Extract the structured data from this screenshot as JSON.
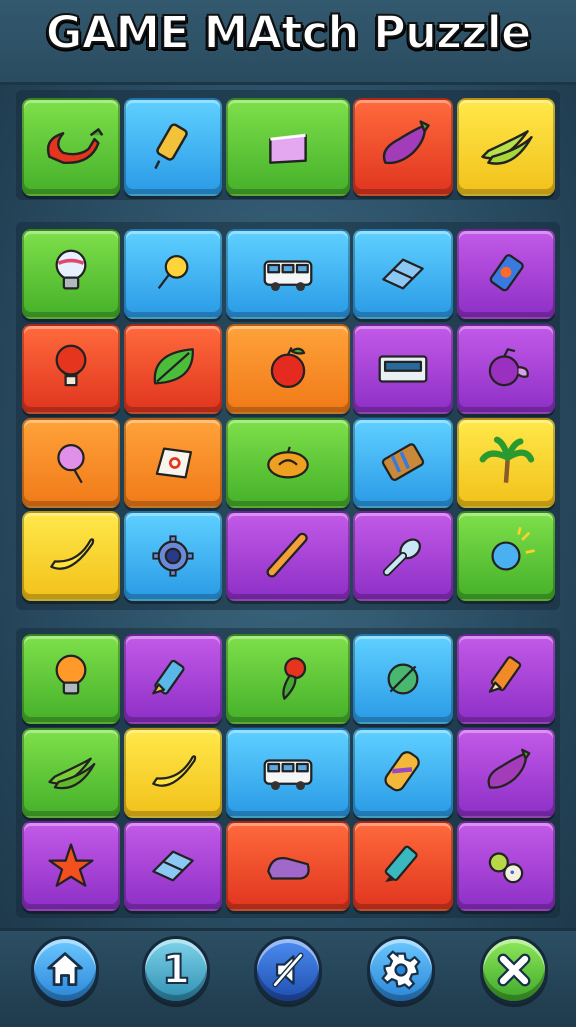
{
  "title": "GAME MAtch Puzzle",
  "colors": {
    "green": "#45b02a",
    "blue": "#2a9ae6",
    "red": "#e0351f",
    "yellow": "#f2c11a",
    "purple": "#8d2fc6",
    "orange": "#f07a18"
  },
  "board": {
    "top_row": [
      {
        "color": "green",
        "item": "chili-pepper-icon"
      },
      {
        "color": "blue",
        "item": "golden-toy-icon"
      },
      {
        "color": "green",
        "item": "pink-crate-icon"
      },
      {
        "color": "red",
        "item": "eggplant-icon"
      },
      {
        "color": "yellow",
        "item": "banana-bunch-icon"
      }
    ],
    "middle_rows": [
      [
        {
          "color": "green",
          "item": "lightbulb-icon"
        },
        {
          "color": "blue",
          "item": "corn-pin-icon"
        },
        {
          "color": "blue",
          "item": "van-icon"
        },
        {
          "color": "blue",
          "item": "eraser-icon"
        },
        {
          "color": "purple",
          "item": "soda-can-icon"
        }
      ],
      [
        {
          "color": "red",
          "item": "hot-air-balloon-icon"
        },
        {
          "color": "red",
          "item": "leaf-icon"
        },
        {
          "color": "orange",
          "item": "apple-icon"
        },
        {
          "color": "purple",
          "item": "radio-icon"
        },
        {
          "color": "purple",
          "item": "purple-apple-icon"
        }
      ],
      [
        {
          "color": "orange",
          "item": "cotton-candy-icon"
        },
        {
          "color": "orange",
          "item": "tag-icon"
        },
        {
          "color": "green",
          "item": "pumpkin-icon"
        },
        {
          "color": "blue",
          "item": "toy-box-icon"
        },
        {
          "color": "yellow",
          "item": "palm-tree-icon"
        }
      ],
      [
        {
          "color": "yellow",
          "item": "banana-icon"
        },
        {
          "color": "blue",
          "item": "gear-icon"
        },
        {
          "color": "purple",
          "item": "baton-icon"
        },
        {
          "color": "purple",
          "item": "spoon-icon"
        },
        {
          "color": "green",
          "item": "planet-icon"
        }
      ]
    ],
    "bottom_rows": [
      [
        {
          "color": "green",
          "item": "orange-bulb-icon"
        },
        {
          "color": "purple",
          "item": "crayon-icon"
        },
        {
          "color": "green",
          "item": "pepper-icon"
        },
        {
          "color": "blue",
          "item": "compass-icon"
        },
        {
          "color": "purple",
          "item": "orange-crayon-icon"
        }
      ],
      [
        {
          "color": "green",
          "item": "green-banana-icon"
        },
        {
          "color": "yellow",
          "item": "banana-icon"
        },
        {
          "color": "blue",
          "item": "van-icon"
        },
        {
          "color": "blue",
          "item": "striped-cylinder-icon"
        },
        {
          "color": "purple",
          "item": "eggplant-icon"
        }
      ],
      [
        {
          "color": "purple",
          "item": "starfish-icon"
        },
        {
          "color": "purple",
          "item": "eraser-icon"
        },
        {
          "color": "red",
          "item": "shoe-icon"
        },
        {
          "color": "red",
          "item": "marker-icon"
        },
        {
          "color": "purple",
          "item": "cookie-icon"
        }
      ]
    ]
  },
  "toolbar": {
    "level_label": "1",
    "buttons": [
      {
        "name": "home-button",
        "icon": "home-icon",
        "color": "#3aa6ea"
      },
      {
        "name": "level-button",
        "icon": "number-one-icon",
        "color": "#3c9ec0"
      },
      {
        "name": "sound-toggle-button",
        "icon": "sound-off-icon",
        "color": "#2c63c8"
      },
      {
        "name": "settings-button",
        "icon": "gear-icon",
        "color": "#3aa6ea"
      },
      {
        "name": "close-button",
        "icon": "close-icon",
        "color": "#5cc833"
      }
    ]
  }
}
